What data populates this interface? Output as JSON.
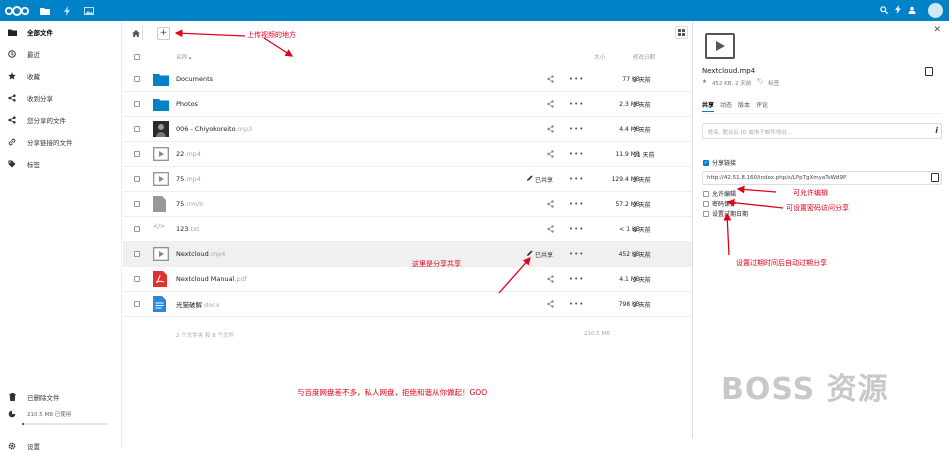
{
  "topbar": {
    "brand_color": "#0082c9"
  },
  "sidebar": {
    "items": [
      {
        "label": "全部文件",
        "icon": "folder-icon",
        "active": true
      },
      {
        "label": "最近",
        "icon": "clock-icon"
      },
      {
        "label": "收藏",
        "icon": "star-icon"
      },
      {
        "label": "收到分享",
        "icon": "share-in-icon"
      },
      {
        "label": "您分享的文件",
        "icon": "share-out-icon"
      },
      {
        "label": "分享链接的文件",
        "icon": "link-icon"
      },
      {
        "label": "标签",
        "icon": "tag-icon"
      }
    ],
    "trash_label": "已删除文件",
    "quota_text": "210.5 MB 已使用",
    "settings_label": "设置"
  },
  "table": {
    "header_name": "名称",
    "header_size": "大小",
    "header_date": "修改日期",
    "share_status": "已共享",
    "rows": [
      {
        "name": "Documents",
        "ext": "",
        "size": "77 KB",
        "date": "2 天前",
        "type": "folder"
      },
      {
        "name": "Photos",
        "ext": "",
        "size": "2.3 MB",
        "date": "2 天前",
        "type": "folder"
      },
      {
        "name": "006 - Chiyokoreito",
        "ext": ".mp3",
        "size": "4.4 MB",
        "date": "7 天前",
        "type": "audio"
      },
      {
        "name": "22",
        "ext": ".mp4",
        "size": "11.9 MB",
        "date": "11 天前",
        "type": "video"
      },
      {
        "name": "75",
        "ext": ".mp4",
        "size": "129.4 MB",
        "date": "2 天前",
        "type": "video",
        "shared": true
      },
      {
        "name": "75",
        "ext": ".rmvb",
        "size": "57.2 MB",
        "date": "2 天前",
        "type": "file"
      },
      {
        "name": "123",
        "ext": ".txt",
        "size": "< 1 KB",
        "date": "8 天前",
        "type": "text"
      },
      {
        "name": "Nextcloud",
        "ext": ".mp4",
        "size": "452 KB",
        "date": "2 天前",
        "type": "video",
        "shared": true,
        "highlight": true
      },
      {
        "name": "Nextcloud Manual",
        "ext": ".pdf",
        "size": "4.1 MB",
        "date": "2 天前",
        "type": "pdf"
      },
      {
        "name": "光猫破解",
        "ext": ".docx",
        "size": "798 KB",
        "date": "2 天前",
        "type": "doc"
      }
    ],
    "summary_text": "2 个文件夹 和 8 个文件",
    "summary_size": "210.5 MB"
  },
  "panel": {
    "filename": "Nextcloud.mp4",
    "size_date": "452 KB, 2 天前",
    "tag_label": "标签",
    "tabs": [
      "共享",
      "动态",
      "版本",
      "评论"
    ],
    "share_placeholder": "姓名, 联合云 ID 或电子邮件地址...",
    "share_link_label": "分享链接",
    "link_url": "http://42.51.8.160/index.php/s/LPpTgXmyaTsWd9P",
    "opt_edit": "允许编辑",
    "opt_password": "密码保护",
    "opt_expire": "设置过期日期"
  },
  "annotations": {
    "upload": "上传视频的地方",
    "share_here": "这里是分享共享",
    "allow_edit": "可允许编辑",
    "password": "可设置密码访问分享",
    "expire": "设置过期时间后自动过期分享",
    "bottom": "与百度网盘差不多，私人网盘，拒绝和谐从你做起！GOO",
    "color": "#e2001a"
  },
  "watermark": "BOSS 资源"
}
